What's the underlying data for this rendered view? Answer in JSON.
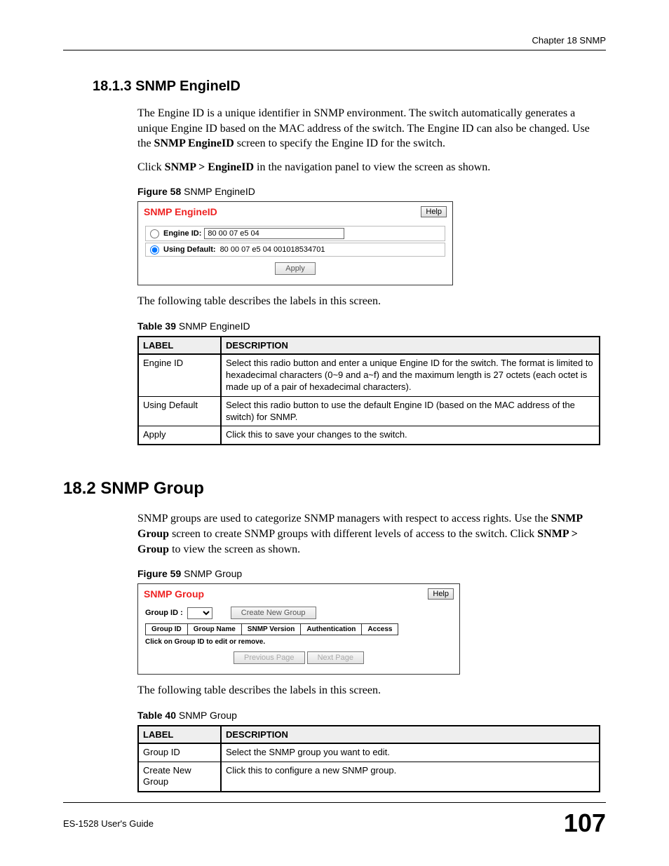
{
  "header": {
    "chapter": "Chapter 18 SNMP"
  },
  "sec1": {
    "heading": "18.1.3  SNMP EngineID",
    "p1_a": "The Engine ID is a unique identifier in SNMP environment. The switch automatically generates a unique Engine ID based on the MAC address of the switch. The Engine ID can also be changed. Use the ",
    "p1_b": "SNMP EngineID",
    "p1_c": " screen to specify the Engine ID for the switch.",
    "p2_a": "Click ",
    "p2_b": "SNMP > EngineID",
    "p2_c": " in the navigation panel to view the screen as shown.",
    "fig_caption": {
      "head": "Figure 58",
      "title": "   SNMP EngineID"
    },
    "ss": {
      "title": "SNMP EngineID",
      "help": "Help",
      "engine_id_label": "Engine ID:",
      "engine_id_value": "80 00 07 e5 04",
      "default_label": "Using Default:",
      "default_value": "80 00 07 e5 04 001018534701",
      "apply": "Apply"
    },
    "after_fig": "The following table describes the labels in this screen.",
    "tbl_caption": {
      "head": "Table 39",
      "title": "   SNMP EngineID"
    },
    "table": {
      "head_label": "LABEL",
      "head_desc": "DESCRIPTION",
      "rows": [
        {
          "label": "Engine ID",
          "desc": "Select this radio button and enter a unique Engine ID for the switch. The format is limited to hexadecimal characters (0~9 and a~f) and the maximum length is 27 octets (each octet is made up of a pair of hexadecimal characters)."
        },
        {
          "label": "Using Default",
          "desc": "Select this radio button to use the default Engine ID (based on the MAC address of the switch) for SNMP."
        },
        {
          "label": "Apply",
          "desc": "Click this to save your changes to the switch."
        }
      ]
    }
  },
  "sec2": {
    "heading": "18.2  SNMP Group",
    "p1_a": "SNMP groups are used to categorize SNMP managers with respect to access rights. Use the ",
    "p1_b": "SNMP Group",
    "p1_c": " screen to create SNMP groups with different levels of access to the switch. Click ",
    "p1_d": "SNMP > Group",
    "p1_e": " to view the screen as shown.",
    "fig_caption": {
      "head": "Figure 59",
      "title": "   SNMP Group"
    },
    "ss": {
      "title": "SNMP Group",
      "help": "Help",
      "group_id_label": "Group ID :",
      "create_btn": "Create New Group",
      "cols": [
        "Group ID",
        "Group Name",
        "SNMP Version",
        "Authentication",
        "Access"
      ],
      "hint": "Click on Group ID to edit or remove.",
      "prev": "Previous Page",
      "next": "Next Page"
    },
    "after_fig": "The following table describes the labels in this screen.",
    "tbl_caption": {
      "head": "Table 40",
      "title": "   SNMP Group"
    },
    "table": {
      "head_label": "LABEL",
      "head_desc": "DESCRIPTION",
      "rows": [
        {
          "label": "Group ID",
          "desc": "Select the SNMP group you want to edit."
        },
        {
          "label": "Create New Group",
          "desc": "Click this to configure a new SNMP group."
        }
      ]
    }
  },
  "footer": {
    "left": "ES-1528 User's Guide",
    "page": "107"
  }
}
